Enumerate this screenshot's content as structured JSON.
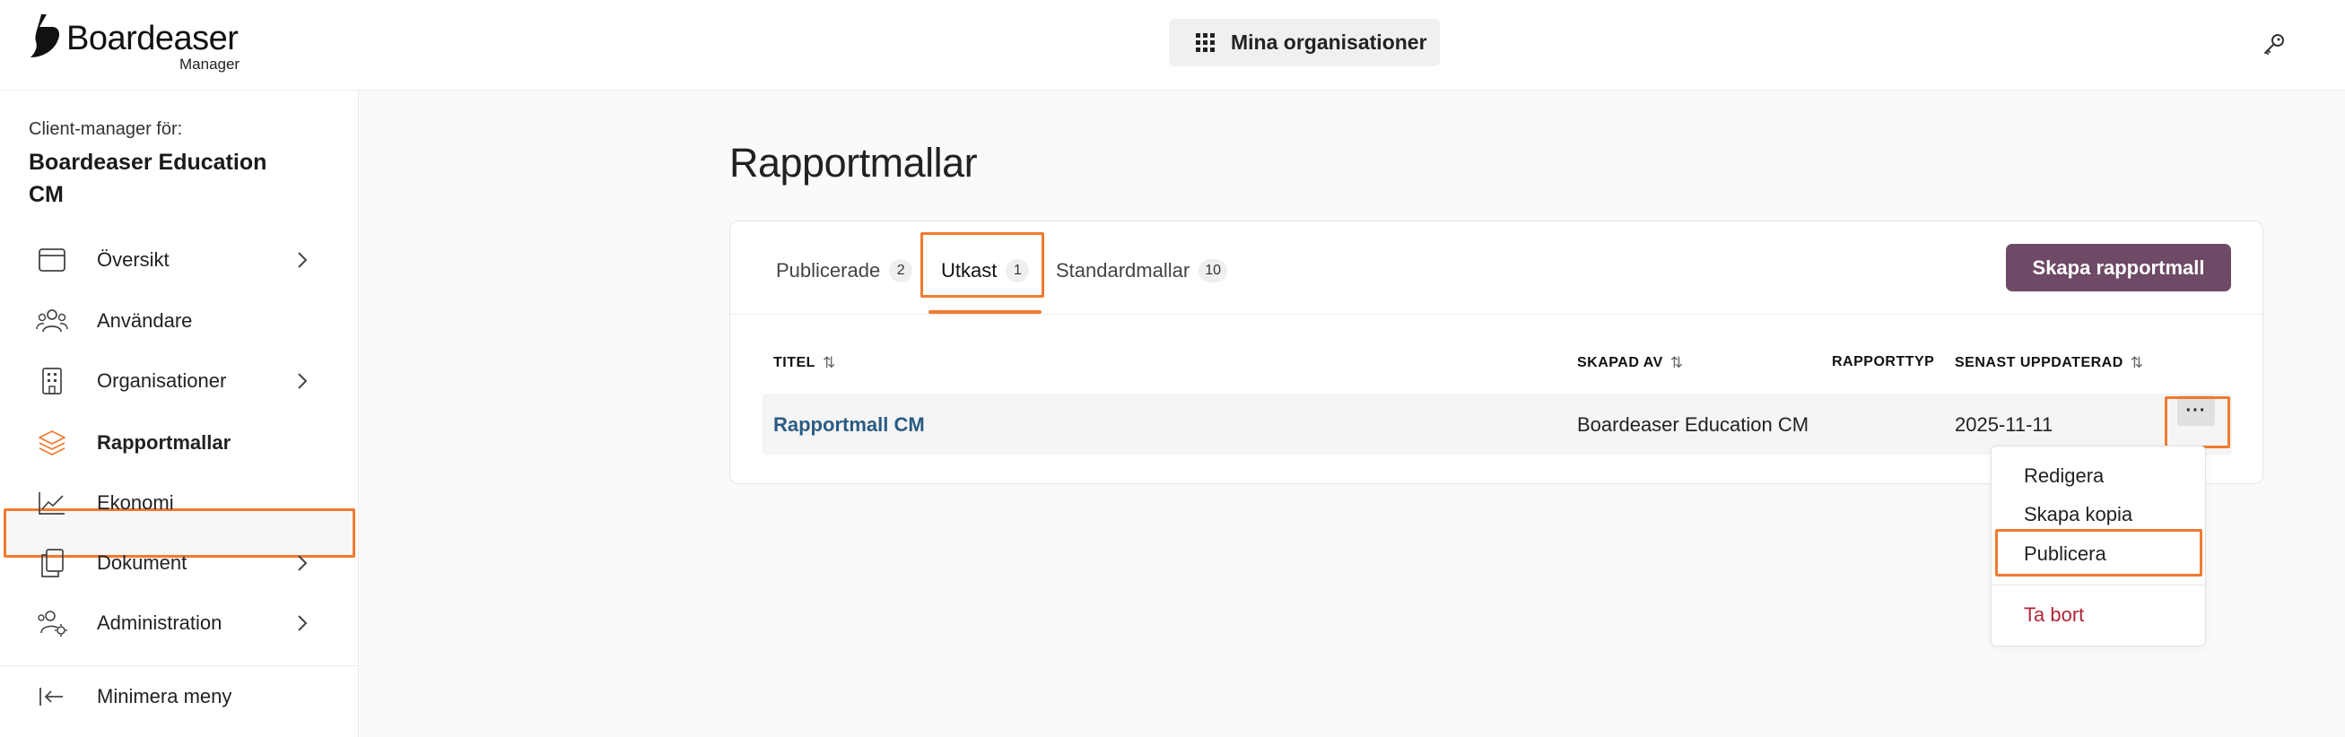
{
  "brand": {
    "name": "Boardeaser",
    "sub": "Manager"
  },
  "topbar": {
    "org_button_label": "Mina organisationer"
  },
  "sidebar": {
    "client_manager_label": "Client-manager för:",
    "client_manager_name": "Boardeaser Education CM",
    "items": [
      {
        "label": "Översikt",
        "icon": "calendar-window-icon",
        "has_chevron": true
      },
      {
        "label": "Användare",
        "icon": "users-icon",
        "has_chevron": false
      },
      {
        "label": "Organisationer",
        "icon": "building-icon",
        "has_chevron": true
      },
      {
        "label": "Rapportmallar",
        "icon": "layers-icon",
        "has_chevron": false,
        "active": true
      },
      {
        "label": "Ekonomi",
        "icon": "line-chart-icon",
        "has_chevron": false
      },
      {
        "label": "Dokument",
        "icon": "documents-icon",
        "has_chevron": true
      },
      {
        "label": "Administration",
        "icon": "users-gear-icon",
        "has_chevron": true
      }
    ],
    "minimize_label": "Minimera meny"
  },
  "main": {
    "title": "Rapportmallar",
    "tabs": [
      {
        "label": "Publicerade",
        "count": "2"
      },
      {
        "label": "Utkast",
        "count": "1",
        "active": true
      },
      {
        "label": "Standardmallar",
        "count": "10"
      }
    ],
    "create_button": "Skapa rapportmall",
    "table": {
      "headers": {
        "title": "TITEL",
        "created_by": "SKAPAD AV",
        "report_type": "RAPPORTTYP",
        "updated": "SENAST UPPDATERAD"
      },
      "rows": [
        {
          "title": "Rapportmall CM",
          "created_by": "Boardeaser Education CM",
          "report_type": "",
          "updated": "2025-11-11"
        }
      ]
    },
    "more_button": "···"
  },
  "row_menu": {
    "items": [
      "Redigera",
      "Skapa kopia",
      "Publicera"
    ],
    "danger_item": "Ta bort"
  },
  "colors": {
    "accent": "#f07a30",
    "primary_button": "#6e4a66",
    "link": "#2a5b82",
    "danger": "#b0263a"
  }
}
